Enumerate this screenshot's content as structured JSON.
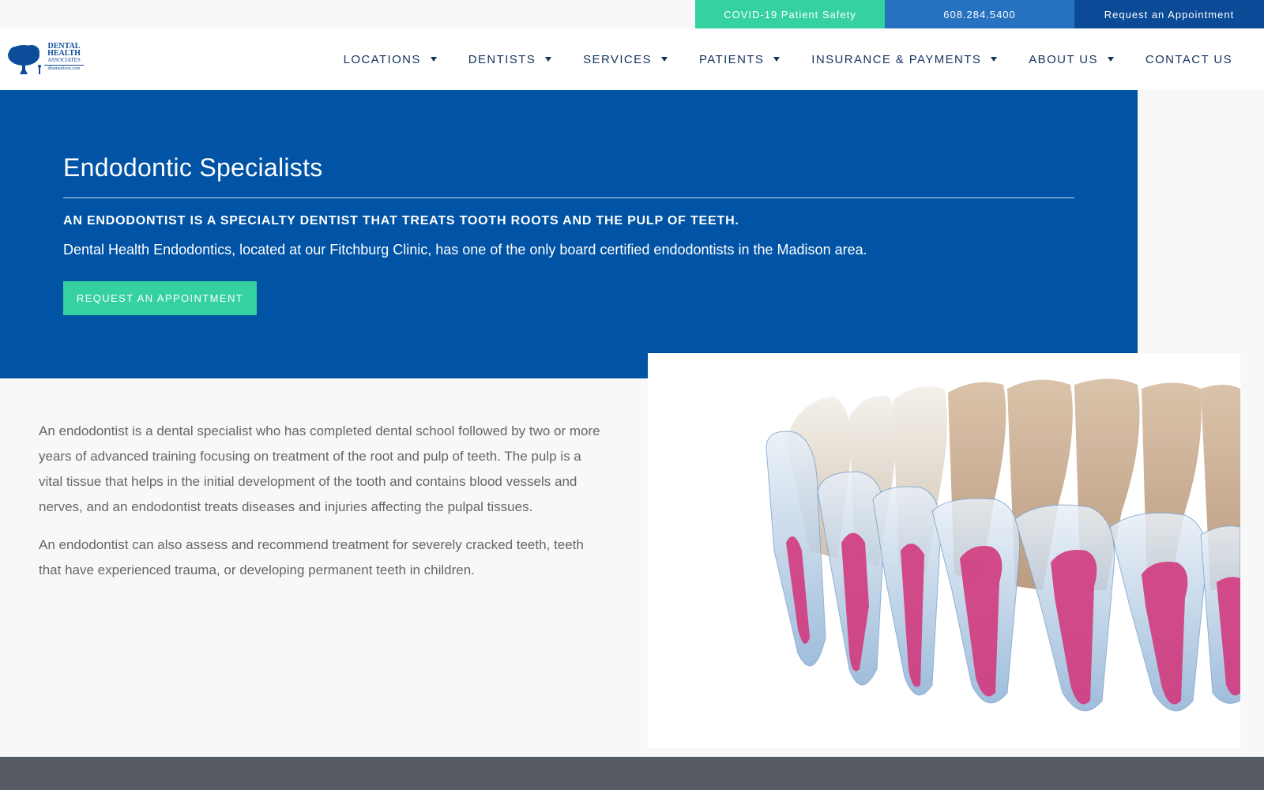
{
  "topbar": {
    "covid": "COVID-19 Patient Safety",
    "phone": "608.284.5400",
    "appointment": "Request an Appointment"
  },
  "logo": {
    "line1": "DENTAL",
    "line2": "HEALTH",
    "line3": "ASSOCIATES",
    "line4": "dhamadison.com",
    "icon": "tree-icon"
  },
  "nav": {
    "items": [
      {
        "label": "LOCATIONS",
        "dropdown": true
      },
      {
        "label": "DENTISTS",
        "dropdown": true
      },
      {
        "label": "SERVICES",
        "dropdown": true
      },
      {
        "label": "PATIENTS",
        "dropdown": true
      },
      {
        "label": "INSURANCE & PAYMENTS",
        "dropdown": true
      },
      {
        "label": "ABOUT US",
        "dropdown": true
      },
      {
        "label": "CONTACT US",
        "dropdown": false
      }
    ]
  },
  "hero": {
    "title": "Endodontic Specialists",
    "tagline": "AN ENDODONTIST IS A SPECIALTY DENTIST THAT TREATS TOOTH ROOTS AND THE PULP OF TEETH.",
    "description": "Dental Health Endodontics, located at our Fitchburg Clinic, has one of the only board certified endodontists in the Madison area.",
    "button": "REQUEST AN APPOINTMENT"
  },
  "content": {
    "paragraphs": [
      "An endodontist is a dental specialist who has completed dental school followed by two or more years of advanced training focusing on treatment of the root and pulp of teeth. The pulp is a vital tissue that helps in the initial development of the tooth and contains blood vessels and nerves, and an endodontist treats diseases and injuries affecting the pulpal tissues.",
      "An endodontist can also assess and recommend treatment for severely cracked teeth, teeth that have experienced trauma, or developing permanent teeth in children."
    ]
  },
  "colors": {
    "green": "#35d1a0",
    "blue_mid": "#2672c0",
    "blue_dark": "#0a4a97",
    "hero_blue": "#0053a5",
    "nav_text": "#15335e",
    "footer": "#565a62"
  }
}
